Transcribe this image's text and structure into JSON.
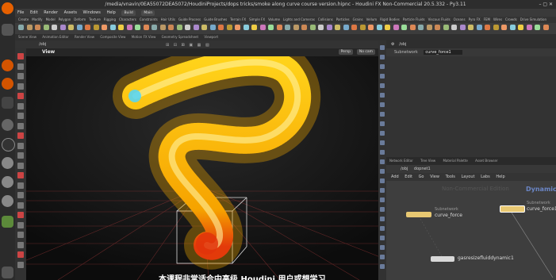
{
  "window": {
    "title": "/media/vnavin/0EA55072DEA5072/HoudiniProjects/dops tricks/smoke along curve course version.hipnc - Houdini FX Non-Commercial 20.5.332 - Py3.11"
  },
  "menubar": {
    "items": [
      "File",
      "Edit",
      "Render",
      "Assets",
      "Windows",
      "Help"
    ],
    "build": "Build",
    "main": "Main"
  },
  "shelf_tabs": [
    "Create",
    "Modify",
    "Model",
    "Polygon",
    "Deform",
    "Texture",
    "Rigging",
    "Characters",
    "Constraints",
    "Hair Utils",
    "Guide Process",
    "Guide Brushes",
    "Terrain FX",
    "Simple FX",
    "Volume",
    "Lights and Cameras",
    "Collisions",
    "Particles",
    "Grains",
    "Vellum",
    "Rigid Bodies",
    "Particle Fluids",
    "Viscous Fluids",
    "Oceans",
    "Pyro FX",
    "FEM",
    "Wires",
    "Crowds",
    "Drive Simulation"
  ],
  "net_tabs": [
    "Network Editor",
    "Tree View",
    "Material Palette",
    "Asset Browser"
  ],
  "viewport": {
    "scene": "/obj",
    "view_label": "View",
    "persp": "Persp",
    "cam": "No cam",
    "pane": "Viewport"
  },
  "params": {
    "path": "/obj",
    "node_type": "Subnetwork",
    "node_name": "curve_force1"
  },
  "network": {
    "path": "/obj",
    "node": "dopnet1",
    "menu": [
      "Add",
      "Edit",
      "Go",
      "View",
      "Tools",
      "Layout",
      "Labs",
      "Help"
    ],
    "watermark": "Non-Commercial Edition",
    "corner_label": "Dynamics",
    "nodes": [
      {
        "type": "Subnetwork",
        "name": "curve_force"
      },
      {
        "type": "Subnetwork",
        "name": "curve_force1"
      },
      {
        "type": "",
        "name": "gasresizefluiddynamic1"
      }
    ]
  },
  "subtitle": "本课程非常适合中高级 Houdini 用户或想学习",
  "colors": {
    "accent_yellow": "#f5c518",
    "node_yellow": "#e8c872",
    "viewport_bg": "#111111",
    "red_header": "#5a1a1a"
  }
}
